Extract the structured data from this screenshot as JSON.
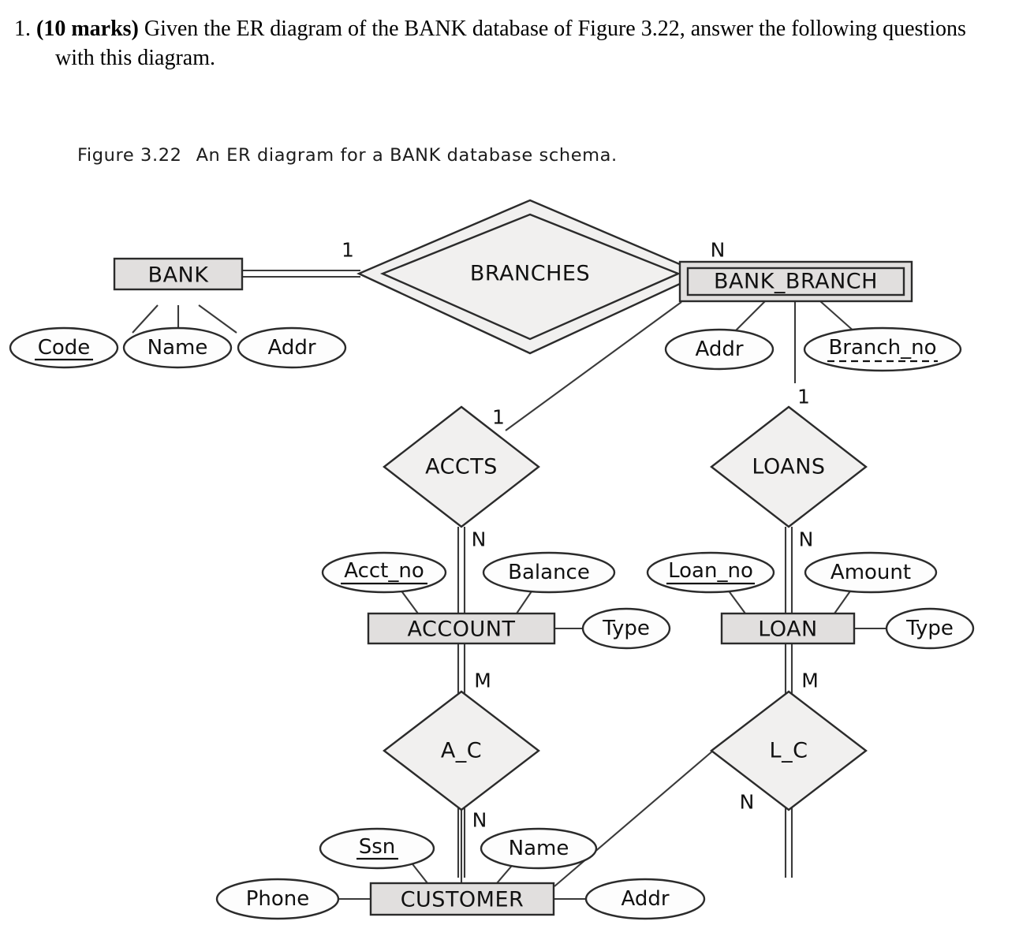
{
  "question": {
    "number": "1.",
    "marks": "(10 marks)",
    "text": "Given the ER diagram of the BANK database of Figure 3.22, answer the following questions with this diagram."
  },
  "figure": {
    "label": "Figure 3.22",
    "caption": "An ER diagram for a BANK database schema."
  },
  "diagram": {
    "entities": [
      {
        "id": "bank",
        "name": "BANK",
        "weak": false
      },
      {
        "id": "bank_branch",
        "name": "BANK_BRANCH",
        "weak": true
      },
      {
        "id": "account",
        "name": "ACCOUNT",
        "weak": false
      },
      {
        "id": "loan",
        "name": "LOAN",
        "weak": false
      },
      {
        "id": "customer",
        "name": "CUSTOMER",
        "weak": false
      }
    ],
    "relationships": [
      {
        "id": "branches",
        "name": "BRANCHES",
        "identifying": true,
        "left_card": "1",
        "right_card": "N"
      },
      {
        "id": "accts",
        "name": "ACCTS",
        "identifying": false,
        "top_card": "1",
        "bottom_card": "N"
      },
      {
        "id": "loans",
        "name": "LOANS",
        "identifying": false,
        "top_card": "1",
        "bottom_card": "N"
      },
      {
        "id": "a_c",
        "name": "A_C",
        "identifying": false,
        "top_card": "M",
        "bottom_card": "N"
      },
      {
        "id": "l_c",
        "name": "L_C",
        "identifying": false,
        "top_card": "M",
        "bottom_card": "N"
      }
    ],
    "attributes": [
      {
        "id": "bank_code",
        "owner": "bank",
        "name": "Code",
        "key": "primary"
      },
      {
        "id": "bank_name",
        "owner": "bank",
        "name": "Name",
        "key": "none"
      },
      {
        "id": "bank_addr",
        "owner": "bank",
        "name": "Addr",
        "key": "none"
      },
      {
        "id": "branch_addr",
        "owner": "bank_branch",
        "name": "Addr",
        "key": "none"
      },
      {
        "id": "branch_no",
        "owner": "bank_branch",
        "name": "Branch_no",
        "key": "partial"
      },
      {
        "id": "acct_no",
        "owner": "account",
        "name": "Acct_no",
        "key": "primary"
      },
      {
        "id": "acct_balance",
        "owner": "account",
        "name": "Balance",
        "key": "none"
      },
      {
        "id": "acct_type",
        "owner": "account",
        "name": "Type",
        "key": "none"
      },
      {
        "id": "loan_no",
        "owner": "loan",
        "name": "Loan_no",
        "key": "primary"
      },
      {
        "id": "loan_amount",
        "owner": "loan",
        "name": "Amount",
        "key": "none"
      },
      {
        "id": "loan_type",
        "owner": "loan",
        "name": "Type",
        "key": "none"
      },
      {
        "id": "cust_ssn",
        "owner": "customer",
        "name": "Ssn",
        "key": "primary"
      },
      {
        "id": "cust_name",
        "owner": "customer",
        "name": "Name",
        "key": "none"
      },
      {
        "id": "cust_phone",
        "owner": "customer",
        "name": "Phone",
        "key": "none"
      },
      {
        "id": "cust_addr",
        "owner": "customer",
        "name": "Addr",
        "key": "none"
      }
    ],
    "cardinality_labels": {
      "bank_branches": "1",
      "branches_bank_branch": "N",
      "accts_top": "1",
      "accts_bottom": "N",
      "loans_top": "1",
      "loans_bottom": "N",
      "ac_top": "M",
      "ac_bottom": "N",
      "lc_top": "M",
      "lc_bottom": "N"
    },
    "colors": {
      "entity_fill": "#e1dfde",
      "relationship_fill": "#f1f0ef",
      "attribute_fill": "#fdfdfd",
      "stroke": "#2b2b2b",
      "background": "#ffffff"
    }
  }
}
